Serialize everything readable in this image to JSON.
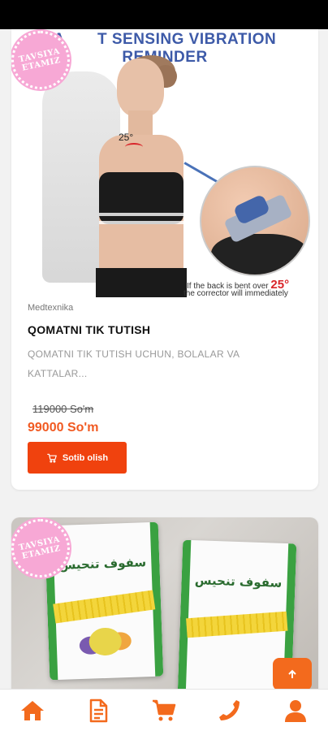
{
  "product1": {
    "banner_text": "A    T SENSING VIBRATION REMINDER",
    "badge_text": [
      "TAVSIYA",
      "ETAMIZ"
    ],
    "angle_label": "25°",
    "caption_line1": "If the back is bent over",
    "caption_angle": "25°",
    "caption_line2": "the corrector will immediately",
    "category": "Medtexnika",
    "title": "QOMATNI TIK TUTISH",
    "description": "QOMATNI TIK TUTISH UCHUN, BOLALAR VA KATTALAR...",
    "old_price": "119000 So'm",
    "new_price": "99000 So'm",
    "buy_label": "Sotib olish"
  },
  "product2": {
    "badge_text": [
      "TAVSIYA",
      "ETAMIZ"
    ],
    "pack_text": "سفوف تنحيس"
  },
  "scroll_top_icon": "arrow-up-icon",
  "nav": {
    "items": [
      {
        "icon": "home-icon"
      },
      {
        "icon": "document-icon"
      },
      {
        "icon": "cart-icon"
      },
      {
        "icon": "phone-icon"
      },
      {
        "icon": "user-icon"
      }
    ]
  },
  "colors": {
    "accent": "#f15a22",
    "button": "#f0420e",
    "badge": "#f7a8d5",
    "banner": "#3d5aa8"
  }
}
